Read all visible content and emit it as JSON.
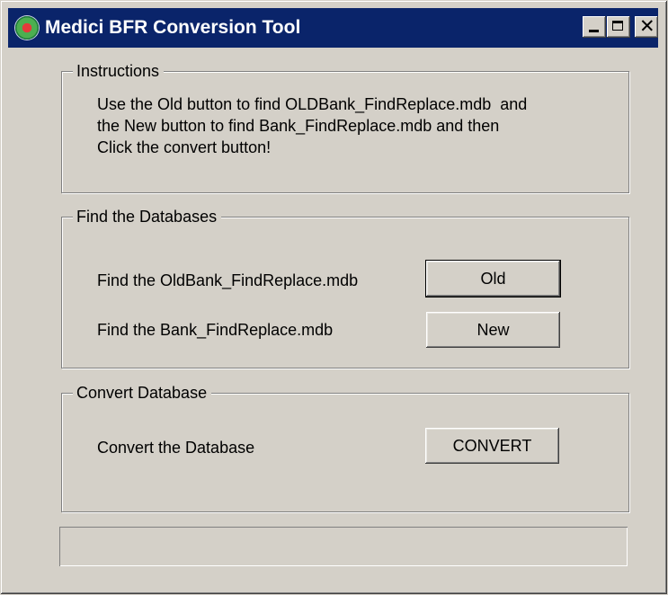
{
  "window": {
    "title": "Medici BFR Conversion Tool",
    "icon": "medici-app-icon",
    "controls": {
      "minimize": "_",
      "maximize": "□",
      "close": "✕"
    }
  },
  "instructions": {
    "label": "Instructions",
    "lines": [
      "Use the Old button to find OLDBank_FindReplace.mdb  and",
      "the New button to find Bank_FindReplace.mdb and then",
      "Click the convert button!"
    ]
  },
  "find": {
    "label": "Find the Databases",
    "old_label": "Find the OldBank_FindReplace.mdb",
    "old_button": "Old",
    "new_label": "Find the Bank_FindReplace.mdb",
    "new_button": "New"
  },
  "convert": {
    "label": "Convert Database",
    "row_label": "Convert the Database",
    "button": "CONVERT"
  },
  "status": {
    "text": ""
  },
  "colors": {
    "titlebar": "#0a246a",
    "face": "#d4d0c8"
  }
}
